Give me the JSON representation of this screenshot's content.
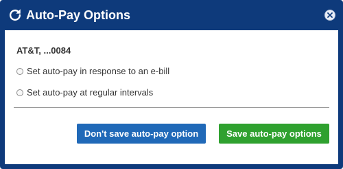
{
  "dialog": {
    "title": "Auto-Pay Options",
    "title_icon": "refresh-icon",
    "close_icon": "close-icon"
  },
  "account": {
    "label": "AT&T, ...0084"
  },
  "options": [
    {
      "label": "Set auto-pay in response to an e-bill",
      "selected": false
    },
    {
      "label": "Set auto-pay at regular intervals",
      "selected": false
    }
  ],
  "buttons": {
    "cancel_label": "Don't save auto-pay option",
    "save_label": "Save auto-pay options"
  },
  "colors": {
    "frame": "#0e3a7b",
    "cancel_button": "#2069b8",
    "save_button": "#2fa12f"
  }
}
